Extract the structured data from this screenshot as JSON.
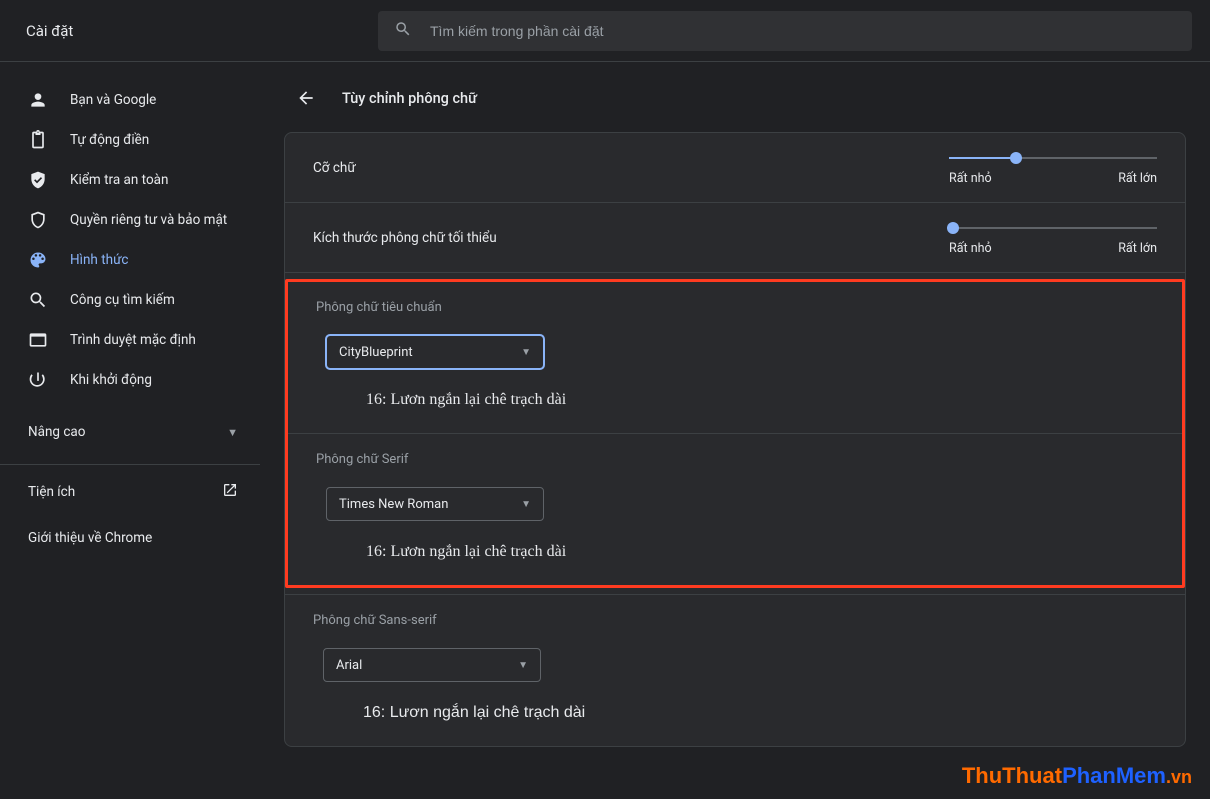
{
  "app_title": "Cài đặt",
  "search": {
    "placeholder": "Tìm kiếm trong phần cài đặt"
  },
  "sidebar": {
    "items": [
      {
        "label": "Bạn và Google"
      },
      {
        "label": "Tự động điền"
      },
      {
        "label": "Kiểm tra an toàn"
      },
      {
        "label": "Quyền riêng tư và bảo mật"
      },
      {
        "label": "Hình thức"
      },
      {
        "label": "Công cụ tìm kiếm"
      },
      {
        "label": "Trình duyệt mặc định"
      },
      {
        "label": "Khi khởi động"
      }
    ],
    "advanced": "Nâng cao",
    "extensions": "Tiện ích",
    "about": "Giới thiệu về Chrome"
  },
  "page": {
    "title": "Tùy chỉnh phông chữ"
  },
  "sliders": {
    "size": {
      "label": "Cỡ chữ",
      "min_label": "Rất nhỏ",
      "max_label": "Rất lớn",
      "percent": 32
    },
    "minsize": {
      "label": "Kích thước phông chữ tối thiểu",
      "min_label": "Rất nhỏ",
      "max_label": "Rất lớn",
      "percent": 2
    }
  },
  "fonts": {
    "standard": {
      "section": "Phông chữ tiêu chuẩn",
      "value": "CityBlueprint",
      "preview": "16: Lươn ngắn lại chê trạch dài"
    },
    "serif": {
      "section": "Phông chữ Serif",
      "value": "Times New Roman",
      "preview": "16: Lươn ngắn lại chê trạch dài"
    },
    "sans": {
      "section": "Phông chữ Sans-serif",
      "value": "Arial",
      "preview": "16: Lươn ngắn lại chê trạch dài"
    }
  },
  "watermark": {
    "a": "ThuThuat",
    "b": "PhanMem",
    "c": ".vn"
  }
}
